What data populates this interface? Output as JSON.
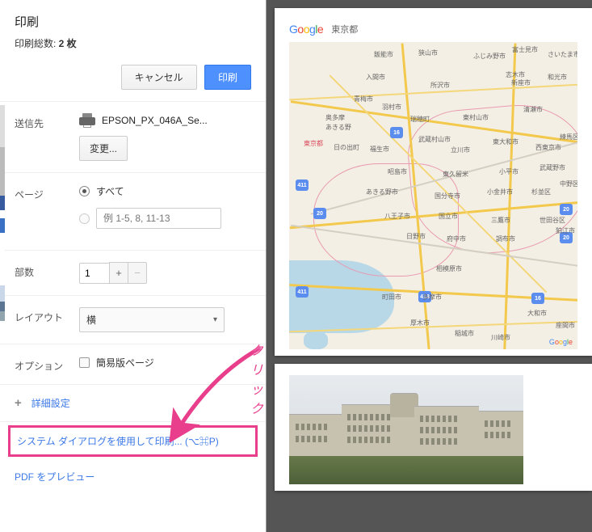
{
  "header": {
    "title": "印刷",
    "total_label": "印刷総数: ",
    "total_value": "2 枚"
  },
  "buttons": {
    "cancel": "キャンセル",
    "print": "印刷",
    "change": "変更..."
  },
  "dest": {
    "label": "送信先",
    "printer_name": "EPSON_PX_046A_Se..."
  },
  "pages": {
    "label": "ページ",
    "all": "すべて",
    "placeholder": "例 1-5, 8, 11-13"
  },
  "copies": {
    "label": "部数",
    "value": "1"
  },
  "layout": {
    "label": "レイアウト",
    "value": "横"
  },
  "options": {
    "label": "オプション",
    "simple": "簡易版ページ"
  },
  "more": {
    "label": "詳細設定"
  },
  "links": {
    "system_dialog": "システム ダイアログを使用して印刷... (⌥⌘P)",
    "pdf_preview": "PDF をプレビュー"
  },
  "annotation": {
    "text": "クリック"
  },
  "preview": {
    "logo_letters": [
      "G",
      "o",
      "o",
      "g",
      "l",
      "e"
    ],
    "search_term": "東京都",
    "map": {
      "tokyo": "東京都",
      "shields": [
        "20",
        "16",
        "411",
        "413",
        "16",
        "20",
        "20",
        "411"
      ],
      "cities": {
        "c1": "飯能市",
        "c2": "狭山市",
        "c3": "ふじみ野市",
        "c4": "入間市",
        "c5": "所沢市",
        "c6": "新座市",
        "c7": "青梅市",
        "c8": "羽村市",
        "c9": "瑞穂町",
        "c10": "東村山市",
        "c11": "清瀬市",
        "c12": "日の出町",
        "c13": "福生市",
        "c14": "武蔵村山市",
        "c15": "立川市",
        "c16": "東大和市",
        "c17": "西東京市",
        "c18": "練馬区",
        "c19": "昭島市",
        "c20": "東久留米",
        "c21": "小平市",
        "c22": "武蔵野市",
        "c23": "中野区",
        "c24": "あきる野市",
        "c25": "国分寺市",
        "c26": "小金井市",
        "c27": "杉並区",
        "c28": "八王子市",
        "c29": "国立市",
        "c30": "三鷹市",
        "c31": "世田谷区",
        "c32": "日野市",
        "c33": "府中市",
        "c34": "調布市",
        "c35": "狛江市",
        "c36": "相模原市",
        "c37": "町田市",
        "c38": "多摩市",
        "c39": "稲城市",
        "c40": "川崎市",
        "c41": "大和市",
        "c42": "座間市",
        "c43": "厚木市",
        "c44": "あきる野",
        "c45": "奥多摩",
        "c46": "富士見市",
        "c47": "さいたま市",
        "c48": "和光市",
        "c49": "志木市"
      }
    }
  }
}
